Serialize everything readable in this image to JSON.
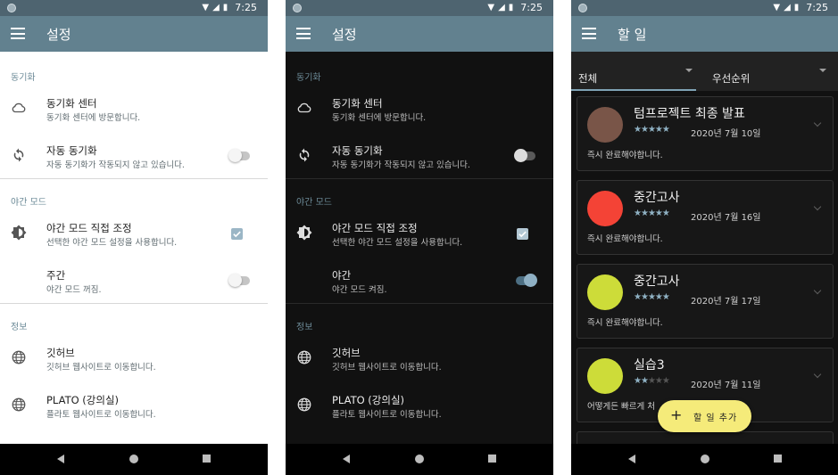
{
  "colors": {
    "appbar": "#62818f",
    "statusbar": "#4e6470",
    "accent": "#7fa3b5",
    "fab": "#f5eb7a"
  },
  "status": {
    "time": "7:25",
    "icons": [
      "wifi-icon",
      "signal-icon",
      "battery-icon"
    ]
  },
  "settings_light": {
    "title": "설정",
    "sections": [
      {
        "header": "동기화",
        "items": [
          {
            "icon": "cloud-icon",
            "title": "동기화 센터",
            "subtitle": "동기화 센터에 방문합니다."
          },
          {
            "icon": "sync-icon",
            "title": "자동 동기화",
            "subtitle": "자동 동기화가 작동되지 않고 있습니다.",
            "control": "switch",
            "checked": false
          }
        ]
      },
      {
        "header": "야간 모드",
        "items": [
          {
            "icon": "brightness-icon",
            "title": "야간 모드 직접 조정",
            "subtitle": "선택한 야간 모드 설정을 사용합니다.",
            "control": "checkbox",
            "checked": true
          },
          {
            "icon": "",
            "title": "주간",
            "subtitle": "야간 모드 꺼짐.",
            "control": "switch",
            "checked": false
          }
        ]
      },
      {
        "header": "정보",
        "items": [
          {
            "icon": "globe-icon",
            "title": "깃허브",
            "subtitle": "깃허브 웹사이트로 이동합니다."
          },
          {
            "icon": "globe-icon",
            "title": "PLATO (강의실)",
            "subtitle": "플라토 웹사이트로 이동합니다."
          }
        ]
      }
    ]
  },
  "settings_dark": {
    "title": "설정",
    "sections": [
      {
        "header": "동기화",
        "items": [
          {
            "icon": "cloud-icon",
            "title": "동기화 센터",
            "subtitle": "동기화 센터에 방문합니다."
          },
          {
            "icon": "sync-icon",
            "title": "자동 동기화",
            "subtitle": "자동 동기화가 작동되지 않고 있습니다.",
            "control": "switch",
            "checked": false
          }
        ]
      },
      {
        "header": "야간 모드",
        "items": [
          {
            "icon": "brightness-icon",
            "title": "야간 모드 직접 조정",
            "subtitle": "선택한 야간 모드 설정을 사용합니다.",
            "control": "checkbox",
            "checked": true
          },
          {
            "icon": "",
            "title": "야간",
            "subtitle": "야간 모드 켜짐.",
            "control": "switch",
            "checked": true
          }
        ]
      },
      {
        "header": "정보",
        "items": [
          {
            "icon": "globe-icon",
            "title": "깃허브",
            "subtitle": "깃허브 웹사이트로 이동합니다."
          },
          {
            "icon": "globe-icon",
            "title": "PLATO (강의실)",
            "subtitle": "플라토 웹사이트로 이동합니다."
          }
        ]
      }
    ]
  },
  "todo": {
    "title": "할 일",
    "filters": [
      {
        "label": "전체",
        "active": true
      },
      {
        "label": "우선순위",
        "active": false
      }
    ],
    "cards": [
      {
        "title": "텀프로젝트 최종 발표",
        "stars": 5,
        "date": "2020년 7월 10일",
        "description": "즉시 완료해야합니다.",
        "color": "#795548"
      },
      {
        "title": "중간고사",
        "stars": 5,
        "date": "2020년 7월 16일",
        "description": "즉시 완료해야합니다.",
        "color": "#f44336"
      },
      {
        "title": "중간고사",
        "stars": 5,
        "date": "2020년 7월 17일",
        "description": "즉시 완료해야합니다.",
        "color": "#cddc39"
      },
      {
        "title": "실습3",
        "stars": 2,
        "date": "2020년 7월 11일",
        "description": "어떻게든 빠르게 처",
        "color": "#cddc39"
      }
    ],
    "fab_label": "할 일 추가",
    "fab_icon": "plus-icon"
  }
}
